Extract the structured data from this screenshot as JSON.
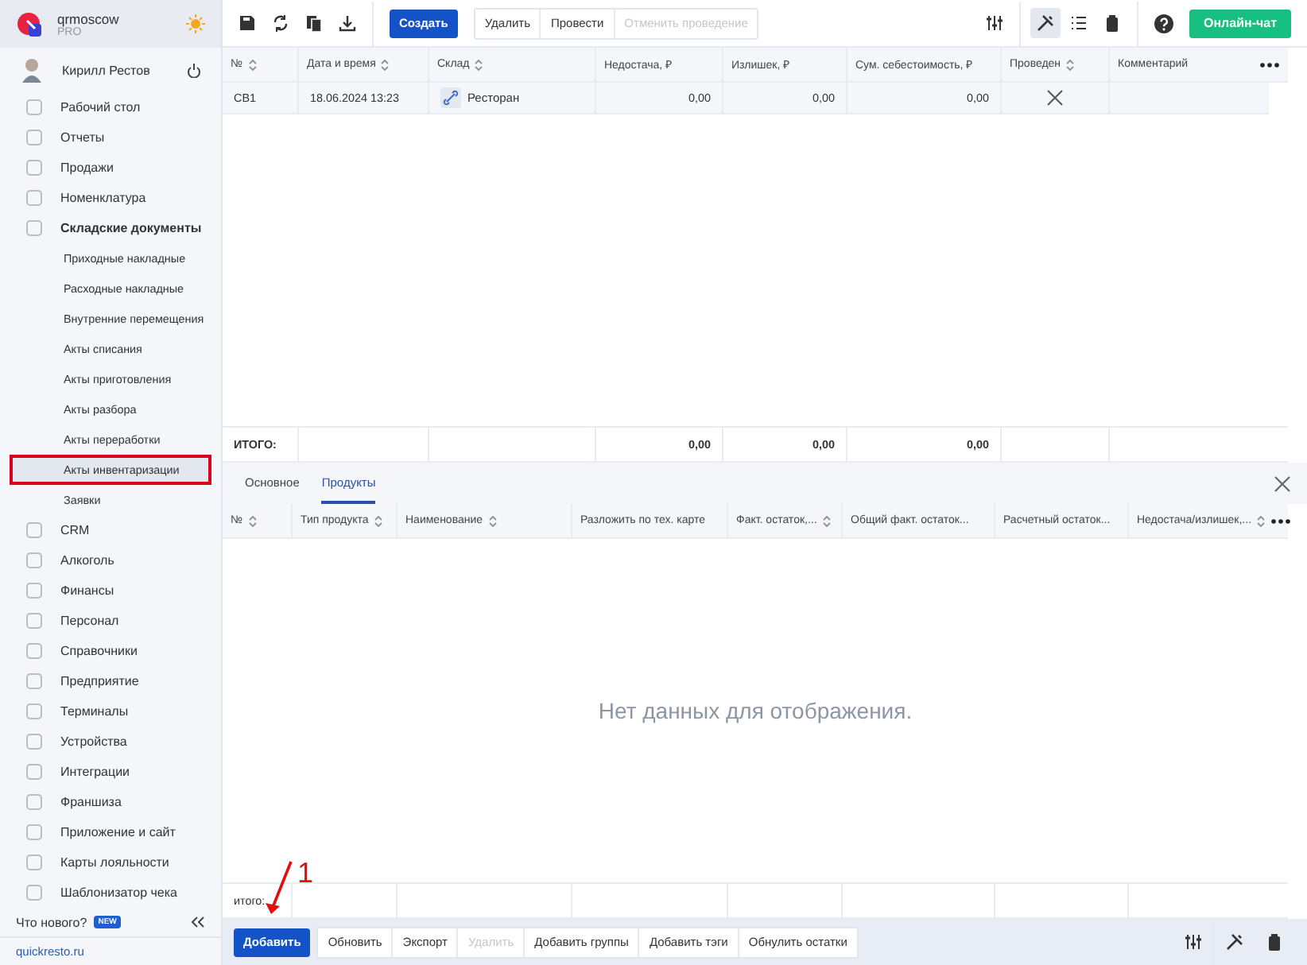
{
  "org": {
    "name": "qrmoscow",
    "plan": "PRO"
  },
  "user": {
    "name": "Кирилл Рестов"
  },
  "sidebar": {
    "items": [
      {
        "label": "Рабочий стол",
        "selected": false
      },
      {
        "label": "Отчеты",
        "selected": false
      },
      {
        "label": "Продажи",
        "selected": false
      },
      {
        "label": "Номенклатура",
        "selected": false
      },
      {
        "label": "Складские документы",
        "selected": false,
        "expanded": true,
        "children": [
          {
            "label": "Приходные накладные",
            "selected": false
          },
          {
            "label": "Расходные накладные",
            "selected": false
          },
          {
            "label": "Внутренние перемещения",
            "selected": false
          },
          {
            "label": "Акты списания",
            "selected": false
          },
          {
            "label": "Акты приготовления",
            "selected": false
          },
          {
            "label": "Акты разбора",
            "selected": false
          },
          {
            "label": "Акты переработки",
            "selected": false
          },
          {
            "label": "Акты инвентаризации",
            "selected": true
          },
          {
            "label": "Заявки",
            "selected": false
          }
        ]
      },
      {
        "label": "CRM",
        "selected": false
      },
      {
        "label": "Алкоголь",
        "selected": false
      },
      {
        "label": "Финансы",
        "selected": false
      },
      {
        "label": "Персонал",
        "selected": false
      },
      {
        "label": "Справочники",
        "selected": false
      },
      {
        "label": "Предприятие",
        "selected": false
      },
      {
        "label": "Терминалы",
        "selected": false
      },
      {
        "label": "Устройства",
        "selected": false
      },
      {
        "label": "Интеграции",
        "selected": false
      },
      {
        "label": "Франшиза",
        "selected": false
      },
      {
        "label": "Приложение и сайт",
        "selected": false
      },
      {
        "label": "Карты лояльности",
        "selected": false
      },
      {
        "label": "Шаблонизатор чека",
        "selected": false
      }
    ],
    "whats_new": "Что нового?",
    "new_badge": "NEW",
    "site_link": "quickresto.ru"
  },
  "toolbar": {
    "buttons": [
      {
        "label": "Создать",
        "kind": "primary",
        "disabled": false
      },
      {
        "label": "Удалить",
        "kind": "group",
        "disabled": false
      },
      {
        "label": "Провести",
        "kind": "group",
        "disabled": false
      },
      {
        "label": "Отменить проведение",
        "kind": "group",
        "disabled": true
      }
    ],
    "chat_button": "Онлайн-чат"
  },
  "table": {
    "columns": [
      {
        "label": "№",
        "sortable": true
      },
      {
        "label": "Дата и время",
        "sortable": true
      },
      {
        "label": "Склад",
        "sortable": true
      },
      {
        "label": "Недостача, ₽",
        "sortable": false
      },
      {
        "label": "Излишек, ₽",
        "sortable": false
      },
      {
        "label": "Сум. себестоимость, ₽",
        "sortable": false
      },
      {
        "label": "Проведен",
        "sortable": true
      },
      {
        "label": "Комментарий",
        "sortable": false
      }
    ],
    "rows": [
      {
        "number": "СВ1",
        "datetime": "18.06.2024 13:23",
        "warehouse": "Ресторан",
        "shortage": "0,00",
        "surplus": "0,00",
        "cost": "0,00",
        "posted": false,
        "comment": ""
      }
    ],
    "totals": {
      "label": "ИТОГО:",
      "shortage": "0,00",
      "surplus": "0,00",
      "cost": "0,00"
    }
  },
  "detail": {
    "tabs": [
      {
        "label": "Основное",
        "selected": false
      },
      {
        "label": "Продукты",
        "selected": true
      }
    ],
    "columns": [
      {
        "label": "№",
        "sortable": true
      },
      {
        "label": "Тип продукта",
        "sortable": true
      },
      {
        "label": "Наименование",
        "sortable": true
      },
      {
        "label": "Разложить по тех. карте",
        "sortable": false
      },
      {
        "label": "Факт. остаток,...",
        "sortable": true
      },
      {
        "label": "Общий факт. остаток...",
        "sortable": false
      },
      {
        "label": "Расчетный остаток...",
        "sortable": false
      },
      {
        "label": "Недостача/излишек,...",
        "sortable": true
      }
    ],
    "empty_message": "Нет данных для отображения.",
    "totals_label": "итого:"
  },
  "bottom_bar": {
    "buttons": [
      {
        "label": "Добавить",
        "kind": "primary",
        "disabled": false
      },
      {
        "label": "Обновить",
        "kind": "group",
        "disabled": false
      },
      {
        "label": "Экспорт",
        "kind": "group",
        "disabled": false
      },
      {
        "label": "Удалить",
        "kind": "group",
        "disabled": true
      },
      {
        "label": "Добавить группы",
        "kind": "group",
        "disabled": false
      },
      {
        "label": "Добавить тэги",
        "kind": "group",
        "disabled": false
      },
      {
        "label": "Обнулить остатки",
        "kind": "group",
        "disabled": false
      }
    ]
  },
  "annotation": {
    "label": "1"
  }
}
